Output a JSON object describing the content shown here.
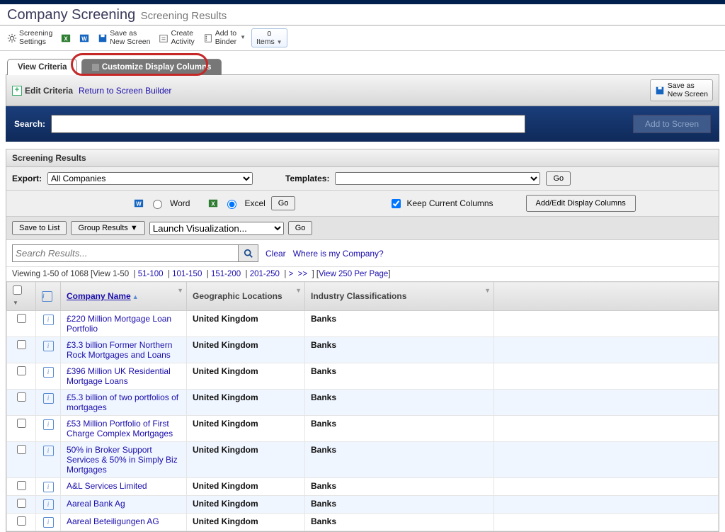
{
  "header": {
    "title": "Company Screening",
    "subtitle": "Screening Results"
  },
  "toolbar": {
    "screening_settings": "Screening\nSettings",
    "save_as_new_screen": "Save as\nNew Screen",
    "create_activity": "Create\nActivity",
    "add_to_binder": "Add to\nBinder",
    "items_count": "0",
    "items_label": "Items"
  },
  "tabs": {
    "view_criteria": "View Criteria",
    "customize_display": "Customize Display Columns"
  },
  "subbar": {
    "edit_criteria": "Edit Criteria",
    "return_link": "Return to Screen Builder",
    "save_as": "Save as\nNew Screen"
  },
  "search": {
    "label": "Search:",
    "value": "",
    "add_btn": "Add to Screen"
  },
  "results": {
    "heading": "Screening Results",
    "export_label": "Export:",
    "export_options": [
      "All Companies"
    ],
    "word_label": "Word",
    "excel_label": "Excel",
    "go": "Go",
    "templates_label": "Templates:",
    "keep_columns": "Keep Current Columns",
    "add_edit_cols": "Add/Edit Display Columns",
    "save_to_list": "Save to List",
    "group_results": "Group Results ▼",
    "launch_viz": "Launch Visualization...",
    "search_placeholder": "Search Results...",
    "clear": "Clear",
    "where_company": "Where is my Company?",
    "pager_prefix": "Viewing 1-50 of 1068 [",
    "view_1_50": "View 1-50",
    "r51": "51-100",
    "r101": "101-150",
    "r151": "151-200",
    "r201": "201-250",
    "view250": "View 250 Per Page",
    "cols": {
      "company": "Company Name",
      "geo": "Geographic Locations",
      "industry": "Industry Classifications"
    },
    "rows": [
      {
        "name": "£220 Million Mortgage Loan Portfolio",
        "geo": "United Kingdom",
        "ind": "Banks"
      },
      {
        "name": "£3.3 billion Former Northern Rock Mortgages and Loans",
        "geo": "United Kingdom",
        "ind": "Banks"
      },
      {
        "name": "£396 Million UK Residential Mortgage Loans",
        "geo": "United Kingdom",
        "ind": "Banks"
      },
      {
        "name": "£5.3 billion of two portfolios of mortgages",
        "geo": "United Kingdom",
        "ind": "Banks"
      },
      {
        "name": "£53 Million Portfolio of First Charge Complex Mortgages",
        "geo": "United Kingdom",
        "ind": "Banks"
      },
      {
        "name": "50% in Broker Support Services & 50% in Simply Biz Mortgages",
        "geo": "United Kingdom",
        "ind": "Banks"
      },
      {
        "name": "A&L Services Limited",
        "geo": "United Kingdom",
        "ind": "Banks"
      },
      {
        "name": "Aareal Bank Ag",
        "geo": "United Kingdom",
        "ind": "Banks"
      },
      {
        "name": "Aareal Beteiligungen AG",
        "geo": "United Kingdom",
        "ind": "Banks"
      }
    ]
  }
}
